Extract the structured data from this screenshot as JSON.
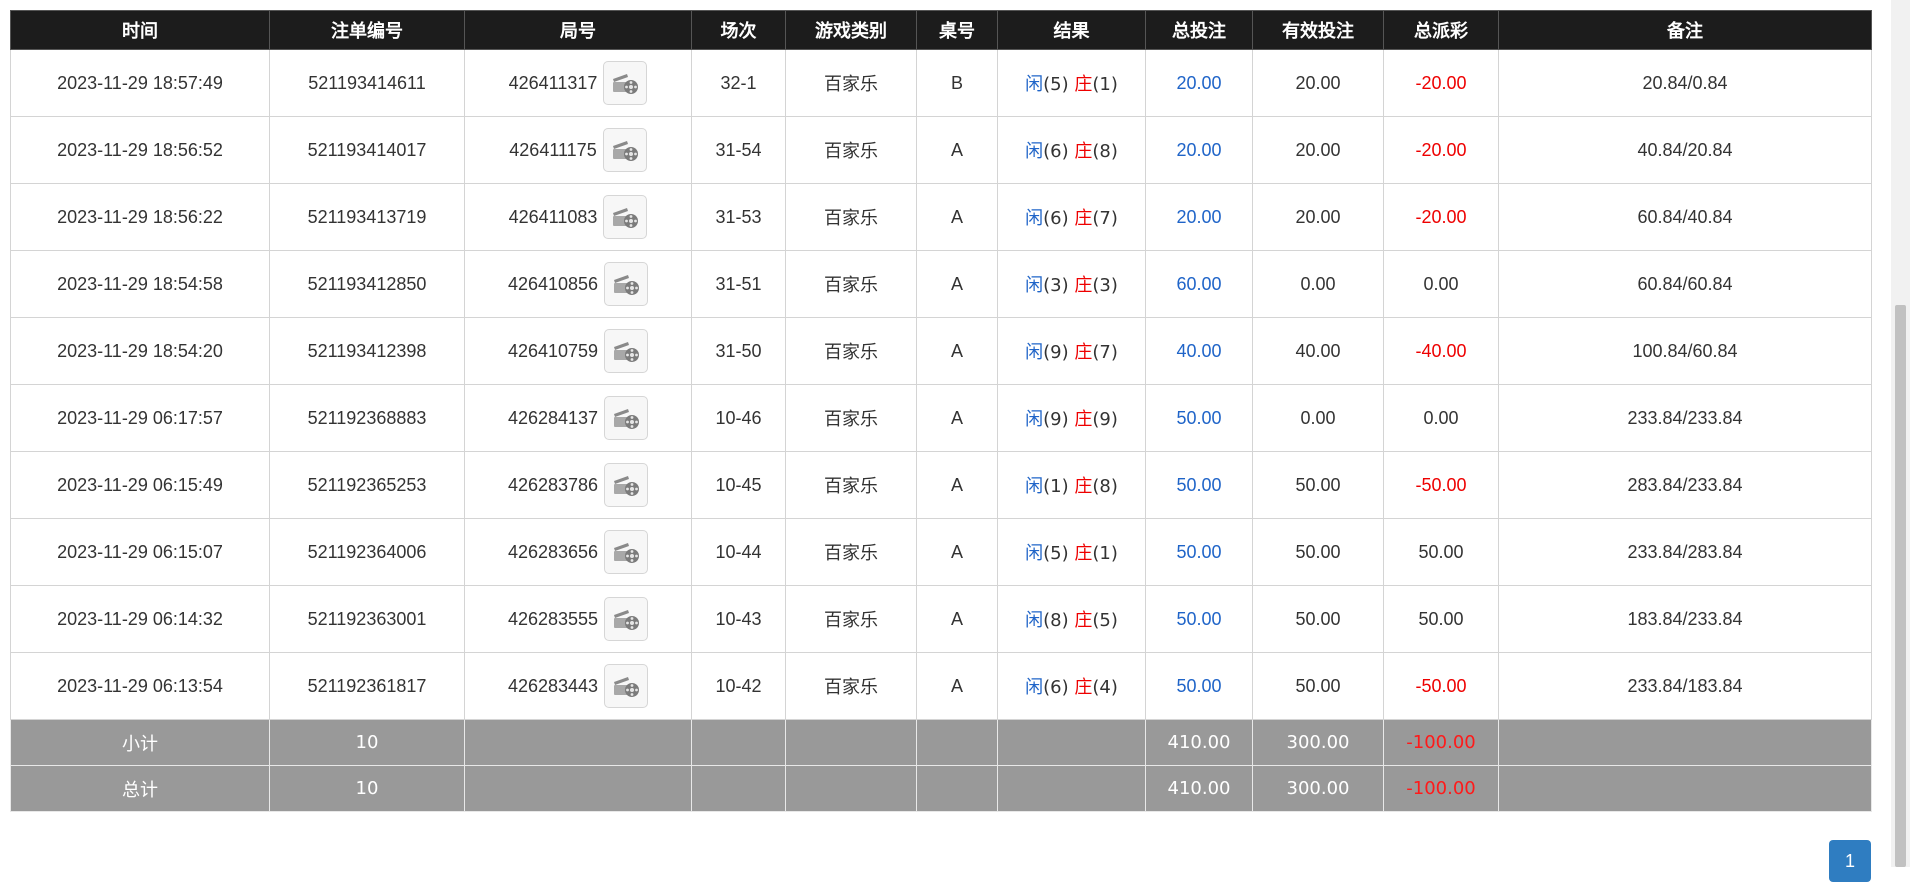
{
  "table": {
    "headers": [
      "时间",
      "注单编号",
      "局号",
      "场次",
      "游戏类别",
      "桌号",
      "结果",
      "总投注",
      "有效投注",
      "总派彩",
      "备注"
    ],
    "rows": [
      {
        "time": "2023-11-29 18:57:49",
        "order_no": "521193414611",
        "round_no": "426411317",
        "session": "32-1",
        "game": "百家乐",
        "table": "B",
        "player_label": "闲",
        "player_score": "(5)",
        "banker_label": "庄",
        "banker_score": "(1)",
        "total_bet": "20.00",
        "valid_bet": "20.00",
        "payout": "-20.00",
        "payout_negative": true,
        "remark": "20.84/0.84"
      },
      {
        "time": "2023-11-29 18:56:52",
        "order_no": "521193414017",
        "round_no": "426411175",
        "session": "31-54",
        "game": "百家乐",
        "table": "A",
        "player_label": "闲",
        "player_score": "(6)",
        "banker_label": "庄",
        "banker_score": "(8)",
        "total_bet": "20.00",
        "valid_bet": "20.00",
        "payout": "-20.00",
        "payout_negative": true,
        "remark": "40.84/20.84"
      },
      {
        "time": "2023-11-29 18:56:22",
        "order_no": "521193413719",
        "round_no": "426411083",
        "session": "31-53",
        "game": "百家乐",
        "table": "A",
        "player_label": "闲",
        "player_score": "(6)",
        "banker_label": "庄",
        "banker_score": "(7)",
        "total_bet": "20.00",
        "valid_bet": "20.00",
        "payout": "-20.00",
        "payout_negative": true,
        "remark": "60.84/40.84"
      },
      {
        "time": "2023-11-29 18:54:58",
        "order_no": "521193412850",
        "round_no": "426410856",
        "session": "31-51",
        "game": "百家乐",
        "table": "A",
        "player_label": "闲",
        "player_score": "(3)",
        "banker_label": "庄",
        "banker_score": "(3)",
        "total_bet": "60.00",
        "valid_bet": "0.00",
        "payout": "0.00",
        "payout_negative": false,
        "remark": "60.84/60.84"
      },
      {
        "time": "2023-11-29 18:54:20",
        "order_no": "521193412398",
        "round_no": "426410759",
        "session": "31-50",
        "game": "百家乐",
        "table": "A",
        "player_label": "闲",
        "player_score": "(9)",
        "banker_label": "庄",
        "banker_score": "(7)",
        "total_bet": "40.00",
        "valid_bet": "40.00",
        "payout": "-40.00",
        "payout_negative": true,
        "remark": "100.84/60.84"
      },
      {
        "time": "2023-11-29 06:17:57",
        "order_no": "521192368883",
        "round_no": "426284137",
        "session": "10-46",
        "game": "百家乐",
        "table": "A",
        "player_label": "闲",
        "player_score": "(9)",
        "banker_label": "庄",
        "banker_score": "(9)",
        "total_bet": "50.00",
        "valid_bet": "0.00",
        "payout": "0.00",
        "payout_negative": false,
        "remark": "233.84/233.84"
      },
      {
        "time": "2023-11-29 06:15:49",
        "order_no": "521192365253",
        "round_no": "426283786",
        "session": "10-45",
        "game": "百家乐",
        "table": "A",
        "player_label": "闲",
        "player_score": "(1)",
        "banker_label": "庄",
        "banker_score": "(8)",
        "total_bet": "50.00",
        "valid_bet": "50.00",
        "payout": "-50.00",
        "payout_negative": true,
        "remark": "283.84/233.84"
      },
      {
        "time": "2023-11-29 06:15:07",
        "order_no": "521192364006",
        "round_no": "426283656",
        "session": "10-44",
        "game": "百家乐",
        "table": "A",
        "player_label": "闲",
        "player_score": "(5)",
        "banker_label": "庄",
        "banker_score": "(1)",
        "total_bet": "50.00",
        "valid_bet": "50.00",
        "payout": "50.00",
        "payout_negative": false,
        "remark": "233.84/283.84"
      },
      {
        "time": "2023-11-29 06:14:32",
        "order_no": "521192363001",
        "round_no": "426283555",
        "session": "10-43",
        "game": "百家乐",
        "table": "A",
        "player_label": "闲",
        "player_score": "(8)",
        "banker_label": "庄",
        "banker_score": "(5)",
        "total_bet": "50.00",
        "valid_bet": "50.00",
        "payout": "50.00",
        "payout_negative": false,
        "remark": "183.84/233.84"
      },
      {
        "time": "2023-11-29 06:13:54",
        "order_no": "521192361817",
        "round_no": "426283443",
        "session": "10-42",
        "game": "百家乐",
        "table": "A",
        "player_label": "闲",
        "player_score": "(6)",
        "banker_label": "庄",
        "banker_score": "(4)",
        "total_bet": "50.00",
        "valid_bet": "50.00",
        "payout": "-50.00",
        "payout_negative": true,
        "remark": "233.84/183.84"
      }
    ],
    "subtotal": {
      "label": "小计",
      "count": "10",
      "total_bet": "410.00",
      "valid_bet": "300.00",
      "payout": "-100.00"
    },
    "grand_total": {
      "label": "总计",
      "count": "10",
      "total_bet": "410.00",
      "valid_bet": "300.00",
      "payout": "-100.00"
    }
  },
  "replay_icon": "film-reel-icon",
  "pagination": {
    "current_page": "1"
  },
  "colors": {
    "header_bg": "#1c1c1c",
    "player": "#1f64c8",
    "banker": "#ee0000",
    "negative": "#ee0000",
    "footer_bg": "#999999",
    "pager": "#2f7dc1"
  }
}
